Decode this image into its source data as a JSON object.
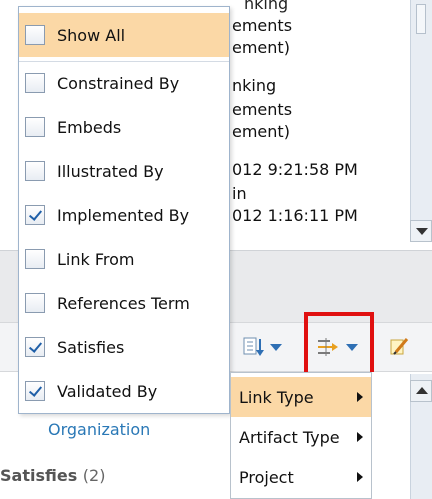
{
  "background": {
    "lines": [
      {
        "text": "ements"
      },
      {
        "text": "ement)"
      },
      {
        "text": "nking"
      },
      {
        "text": "ements"
      },
      {
        "text": "ement)"
      },
      {
        "text": "012 9:21:58 PM"
      },
      {
        "text": "in"
      },
      {
        "text": "012 1:16:11 PM"
      }
    ],
    "top_fragment": "nking",
    "organization_link": "Organization",
    "satisfies_heading": "Satisfies",
    "satisfies_count": "(2)"
  },
  "check_menu": {
    "items": [
      {
        "label": "Show All",
        "checked": false
      },
      {
        "label": "Constrained By",
        "checked": false
      },
      {
        "label": "Embeds",
        "checked": false
      },
      {
        "label": "Illustrated By",
        "checked": false
      },
      {
        "label": "Implemented By",
        "checked": true
      },
      {
        "label": "Link From",
        "checked": false
      },
      {
        "label": "References Term",
        "checked": false
      },
      {
        "label": "Satisfies",
        "checked": true
      },
      {
        "label": "Validated By",
        "checked": true
      }
    ]
  },
  "submenu": {
    "items": [
      {
        "label": "Link Type"
      },
      {
        "label": "Artifact Type"
      },
      {
        "label": "Project"
      }
    ]
  },
  "toolbar": {
    "icons": [
      "sort-icon",
      "filter-links-icon",
      "edit-icon"
    ]
  },
  "colors": {
    "highlight": "#fbd8a6",
    "callout": "#e01010",
    "link": "#2a78b6"
  }
}
